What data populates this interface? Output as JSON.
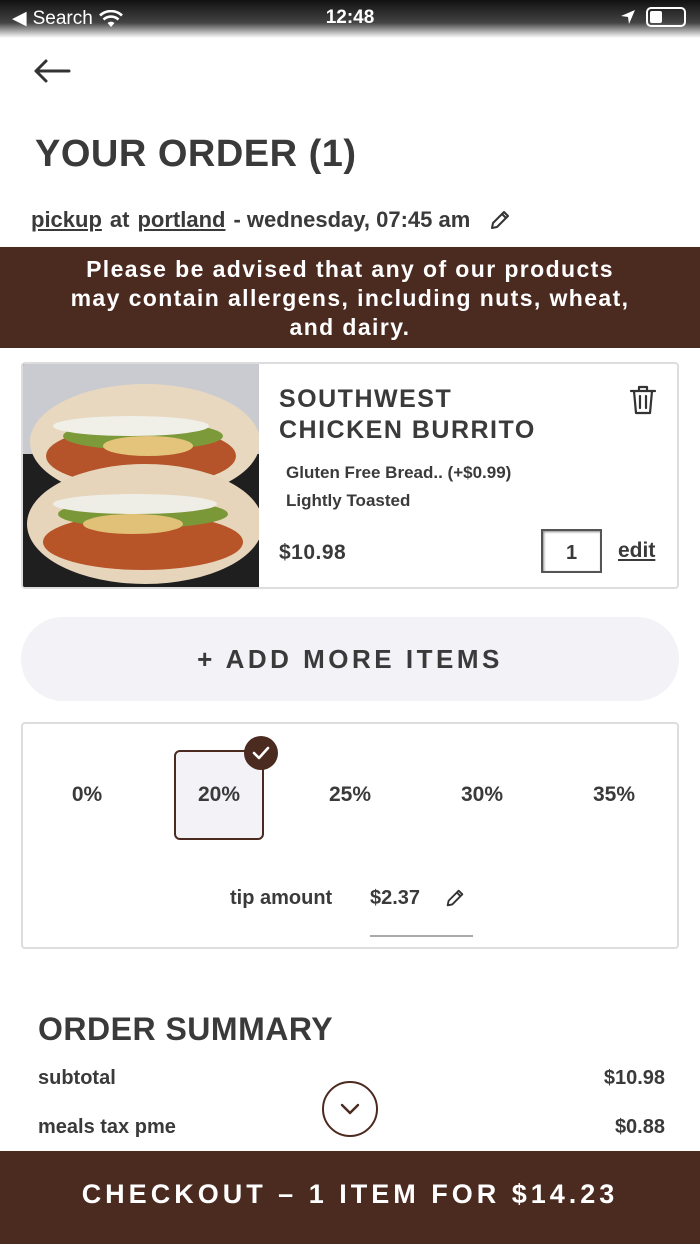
{
  "status_bar": {
    "back_app": "Search",
    "time": "12:48"
  },
  "header": {
    "title": "YOUR ORDER (1)"
  },
  "pickup": {
    "mode": "pickup",
    "at": "at",
    "location": "portland",
    "when": "- wednesday, 07:45 am"
  },
  "allergen": {
    "line1": "Please be advised that any of our products",
    "line2": "may contain allergens, including nuts, wheat,",
    "line3": "and dairy."
  },
  "item": {
    "name_line1": "SOUTHWEST",
    "name_line2": "CHICKEN BURRITO",
    "modifiers": [
      "Gluten Free Bread.. (+$0.99)",
      "Lightly Toasted"
    ],
    "price": "$10.98",
    "quantity": "1",
    "edit_label": "edit"
  },
  "add_more_label": "+ ADD MORE ITEMS",
  "tip": {
    "options": [
      "0%",
      "20%",
      "25%",
      "30%",
      "35%"
    ],
    "selected": "20%",
    "amount_label": "tip amount",
    "amount_value": "$2.37"
  },
  "summary": {
    "title": "ORDER SUMMARY",
    "rows": [
      {
        "label": "subtotal",
        "value": "$10.98"
      },
      {
        "label": "meals tax pme",
        "value": "$0.88"
      }
    ]
  },
  "checkout_label": "CHECKOUT – 1 ITEM FOR $14.23",
  "colors": {
    "brand_brown": "#4b2a20",
    "pill_bg": "#f2f2f7",
    "text": "#3a3a3a"
  }
}
